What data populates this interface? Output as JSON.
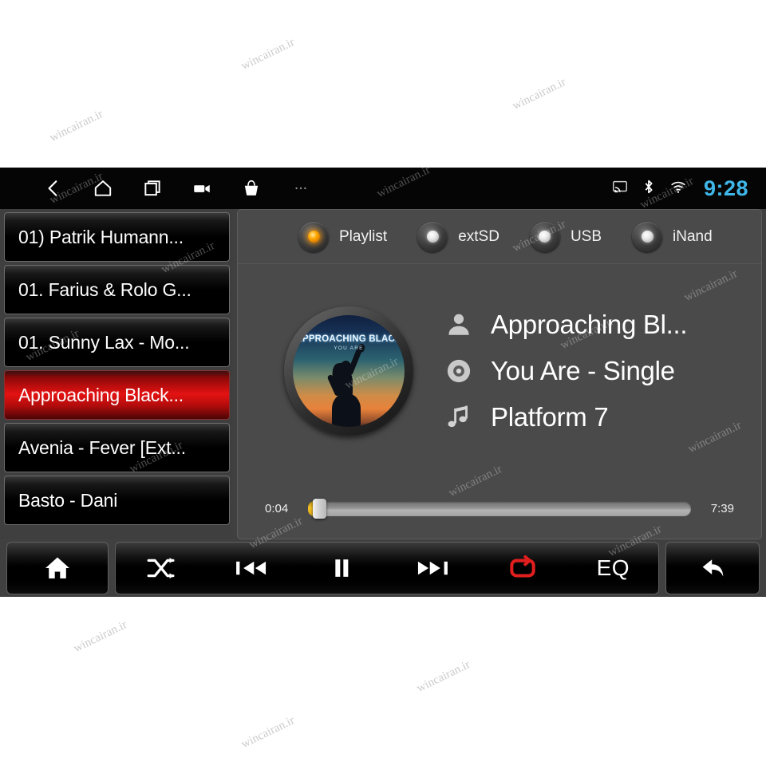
{
  "statusbar": {
    "icons_left": [
      {
        "name": "back-icon",
        "glyph": "back"
      },
      {
        "name": "home-icon",
        "glyph": "home-outline"
      },
      {
        "name": "recent-apps-icon",
        "glyph": "recents"
      },
      {
        "name": "video-camera-icon",
        "glyph": "camcorder"
      },
      {
        "name": "shopping-bag-icon",
        "glyph": "bag"
      },
      {
        "name": "more-options-icon",
        "glyph": "ellipsis"
      }
    ],
    "icons_right": [
      {
        "name": "cast-icon",
        "glyph": "cast"
      },
      {
        "name": "bluetooth-icon",
        "glyph": "bluetooth"
      },
      {
        "name": "wifi-icon",
        "glyph": "wifi"
      }
    ],
    "clock": "9:28",
    "clock_color": "#3fb6e8"
  },
  "playlist": {
    "items": [
      {
        "label": "01) Patrik Humann...",
        "selected": false
      },
      {
        "label": "01. Farius & Rolo G...",
        "selected": false
      },
      {
        "label": "01. Sunny Lax - Mo...",
        "selected": false
      },
      {
        "label": "Approaching Black...",
        "selected": true
      },
      {
        "label": "Avenia - Fever [Ext...",
        "selected": false
      },
      {
        "label": "Basto - Dani",
        "selected": false
      }
    ],
    "selected_color": "#e41212"
  },
  "sources": [
    {
      "label": "Playlist",
      "active": true
    },
    {
      "label": "extSD",
      "active": false
    },
    {
      "label": "USB",
      "active": false
    },
    {
      "label": "iNand",
      "active": false
    }
  ],
  "album_art": {
    "title": "APPROACHING BLACK",
    "subtitle": "YOU ARE"
  },
  "track": {
    "artist": "Approaching Bl...",
    "album": "You Are - Single",
    "title": "Platform 7",
    "artist_icon": "person-icon",
    "album_icon": "disc-icon",
    "title_icon": "music-note-icon"
  },
  "progress": {
    "elapsed": "0:04",
    "total": "7:39",
    "percent": 1.6,
    "fill_color": "#f4c326"
  },
  "controls": {
    "home": {
      "label": "Home",
      "icon": "home-filled-icon"
    },
    "shuffle": {
      "label": "Shuffle",
      "icon": "shuffle-icon"
    },
    "previous": {
      "label": "Previous",
      "icon": "previous-track-icon"
    },
    "pause": {
      "label": "Pause",
      "icon": "pause-icon"
    },
    "next": {
      "label": "Next",
      "icon": "next-track-icon"
    },
    "repeat": {
      "label": "Repeat",
      "icon": "repeat-icon",
      "active": true,
      "active_color": "#e01e1e"
    },
    "eq": {
      "label": "EQ",
      "icon": "equalizer-label"
    },
    "back": {
      "label": "Back",
      "icon": "back-arrow-icon"
    }
  },
  "watermarks": [
    "wincairan.ir",
    "wincairan.ir",
    "wincairan.ir",
    "wincairan.ir",
    "wincairan.ir",
    "wincairan.ir",
    "wincairan.ir",
    "wincairan.ir",
    "wincairan.ir",
    "wincairan.ir",
    "wincairan.ir",
    "wincairan.ir"
  ]
}
